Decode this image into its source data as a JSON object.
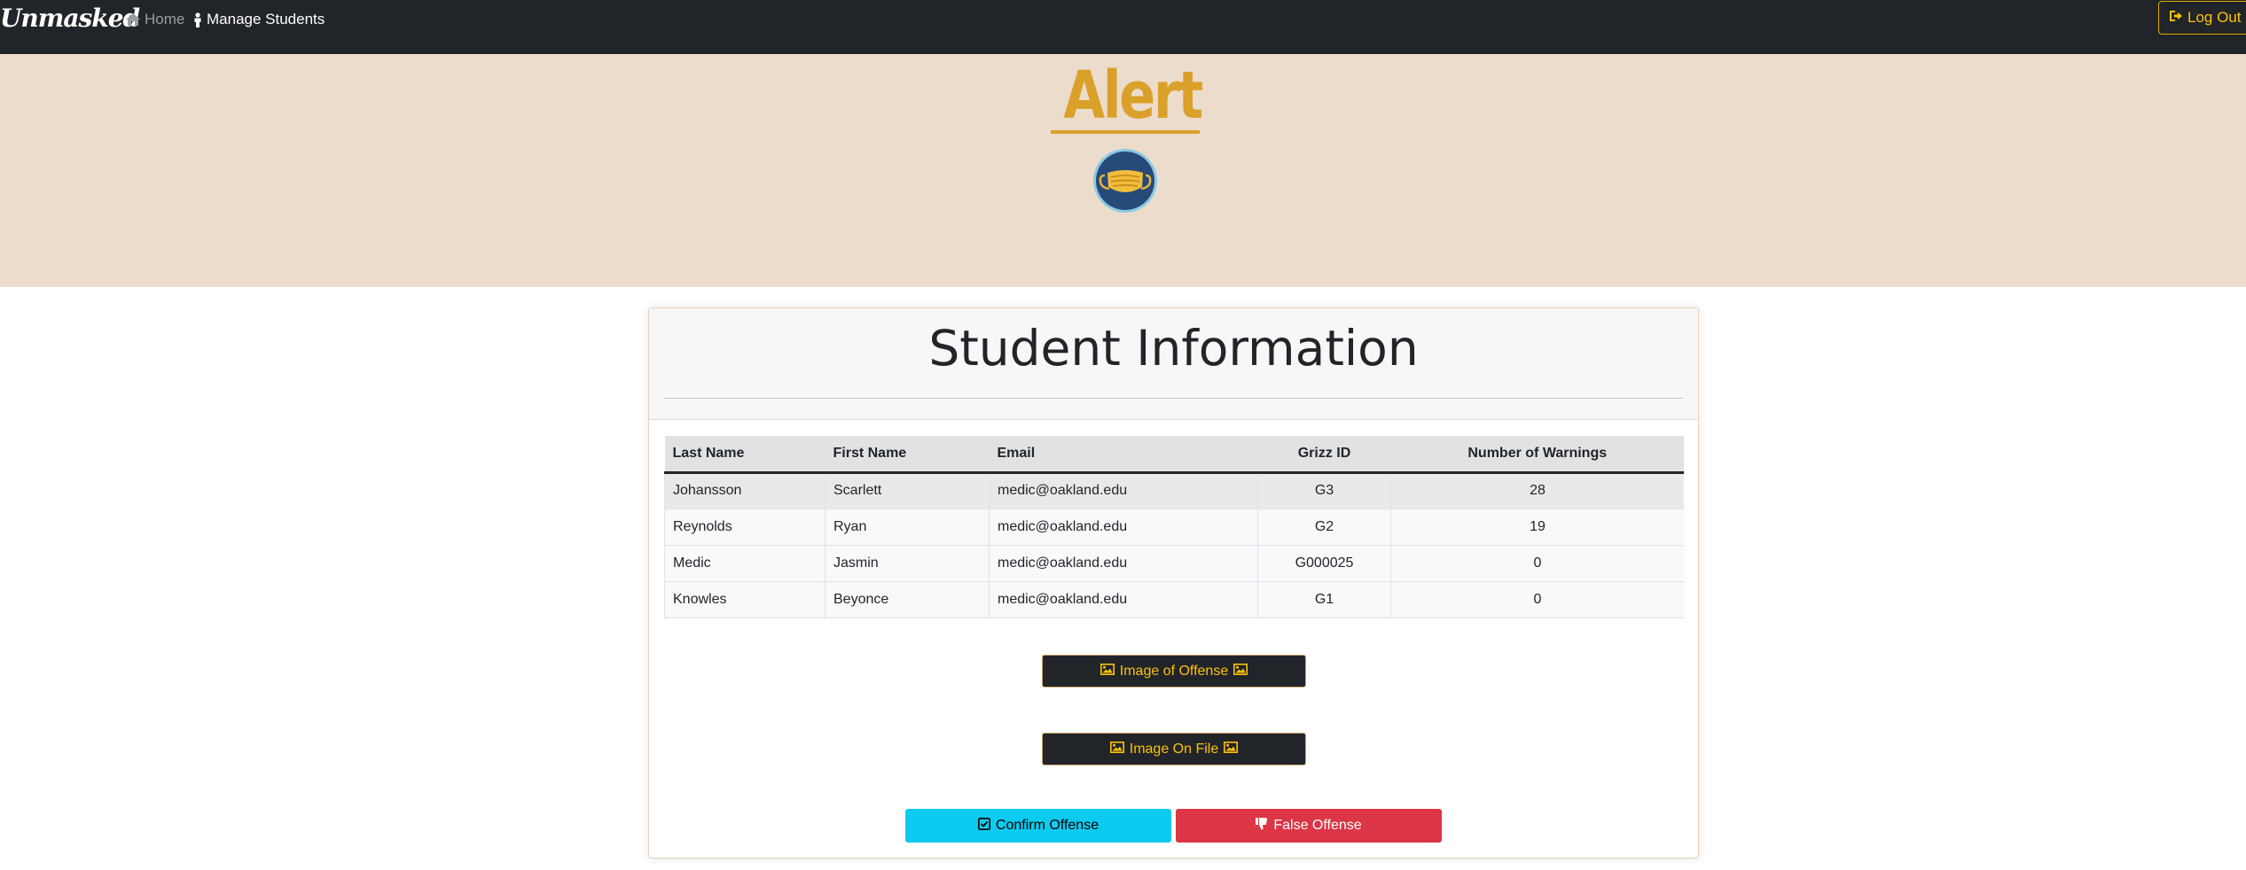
{
  "nav": {
    "brand": "Unmasked",
    "home_label": "Home",
    "manage_label": "Manage Students",
    "logout_label": "Log Out"
  },
  "hero": {
    "title": "Alert"
  },
  "card": {
    "title": "Student Information"
  },
  "table": {
    "headers": [
      "Last Name",
      "First Name",
      "Email",
      "Grizz ID",
      "Number of Warnings"
    ],
    "rows": [
      [
        "Johansson",
        "Scarlett",
        "medic@oakland.edu",
        "G3",
        "28"
      ],
      [
        "Reynolds",
        "Ryan",
        "medic@oakland.edu",
        "G2",
        "19"
      ],
      [
        "Medic",
        "Jasmin",
        "medic@oakland.edu",
        "G000025",
        "0"
      ],
      [
        "Knowles",
        "Beyonce",
        "medic@oakland.edu",
        "G1",
        "0"
      ]
    ]
  },
  "buttons": {
    "image_offense": "Image of Offense",
    "image_on_file": "Image On File",
    "confirm": "Confirm Offense",
    "false_offense": "False Offense"
  },
  "icons": {
    "home": "home-icon",
    "user": "user-icon",
    "logout": "sign-out-icon",
    "image": "image-icon",
    "check": "check-square-icon",
    "thumbs_down": "thumbs-down-icon",
    "mask": "face-mask-icon"
  },
  "colors": {
    "navbar": "#212529",
    "hero_bg": "#ecdccb",
    "accent_gold": "#daa12a",
    "warning": "#ffc107",
    "info": "#0dcaf0",
    "danger": "#dc3545"
  }
}
